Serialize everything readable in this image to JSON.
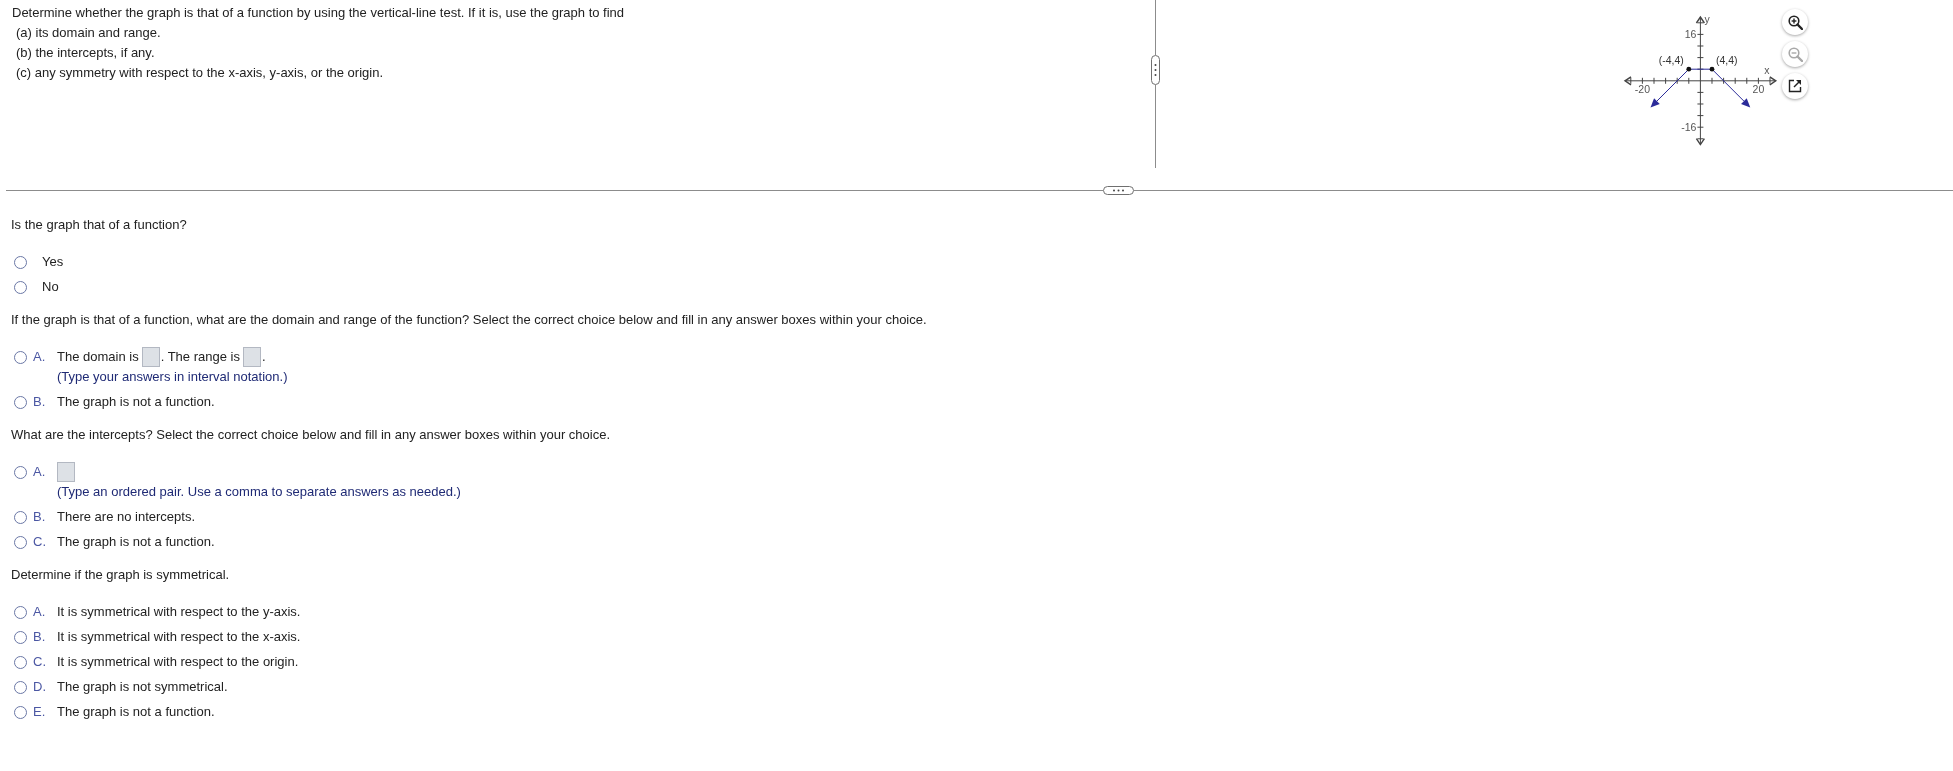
{
  "problem": {
    "intro": "Determine whether the graph is that of a function by using the vertical-line test. If it is, use the graph to find",
    "parts": [
      "(a) its domain and range.",
      "(b) the intercepts, if any.",
      "(c) any symmetry with respect to the x-axis, y-axis, or the origin."
    ]
  },
  "graph": {
    "chart_data": {
      "type": "line",
      "xlabel": "x",
      "ylabel": "y",
      "x": [
        -15,
        -4,
        4,
        15
      ],
      "series": [
        {
          "color": "#2b2b99",
          "values": [
            -7,
            4,
            4,
            -7
          ]
        }
      ],
      "xlim": [
        -26,
        26
      ],
      "ylim": [
        -22,
        22
      ],
      "xticks": [
        -20,
        20
      ],
      "yticks": [
        -16,
        16
      ],
      "annotations": [
        {
          "x": -4,
          "y": 4,
          "text": "(-4,4)"
        },
        {
          "x": 4,
          "y": 4,
          "text": "(4,4)"
        }
      ]
    },
    "tools": [
      {
        "kind": "zoom_in",
        "disabled": false
      },
      {
        "kind": "zoom_out",
        "disabled": true
      },
      {
        "kind": "popout",
        "disabled": false
      }
    ]
  },
  "questions": [
    {
      "prompt": "Is the graph that of a function?",
      "choices": [
        {
          "content": [
            {
              "kind": "text",
              "text": "Yes"
            }
          ],
          "selected": false
        },
        {
          "content": [
            {
              "kind": "text",
              "text": "No"
            }
          ],
          "selected": false
        }
      ]
    },
    {
      "prompt": "If the graph is that of a function, what are the domain and range of the function? Select the correct choice below and fill in any answer boxes within your choice.",
      "choices": [
        {
          "letter": "A.",
          "content": [
            {
              "kind": "text",
              "text": "The domain is"
            },
            {
              "kind": "answer_box"
            },
            {
              "kind": "text",
              "text": ". The range is"
            },
            {
              "kind": "answer_box"
            },
            {
              "kind": "text",
              "text": "."
            }
          ],
          "hint": "(Type your answers in interval notation.)",
          "selected": false
        },
        {
          "letter": "B.",
          "content": [
            {
              "kind": "text",
              "text": "The graph is not a function."
            }
          ],
          "selected": false
        }
      ]
    },
    {
      "prompt": "What are the intercepts? Select the correct choice below and fill in any answer boxes within your choice.",
      "choices": [
        {
          "letter": "A.",
          "content": [
            {
              "kind": "answer_box"
            }
          ],
          "hint": "(Type an ordered pair. Use a comma to separate answers as needed.)",
          "selected": false
        },
        {
          "letter": "B.",
          "content": [
            {
              "kind": "text",
              "text": "There are no intercepts."
            }
          ],
          "selected": false
        },
        {
          "letter": "C.",
          "content": [
            {
              "kind": "text",
              "text": "The graph is not a function."
            }
          ],
          "selected": false
        }
      ]
    },
    {
      "prompt": "Determine if the graph is symmetrical.",
      "choices": [
        {
          "letter": "A.",
          "content": [
            {
              "kind": "text",
              "text": "It is symmetrical with respect to the y-axis."
            }
          ],
          "selected": false
        },
        {
          "letter": "B.",
          "content": [
            {
              "kind": "text",
              "text": "It is symmetrical with respect to the x-axis."
            }
          ],
          "selected": false
        },
        {
          "letter": "C.",
          "content": [
            {
              "kind": "text",
              "text": "It is symmetrical with respect to the origin."
            }
          ],
          "selected": false
        },
        {
          "letter": "D.",
          "content": [
            {
              "kind": "text",
              "text": "The graph is not symmetrical."
            }
          ],
          "selected": false
        },
        {
          "letter": "E.",
          "content": [
            {
              "kind": "text",
              "text": "The graph is not a function."
            }
          ],
          "selected": false
        }
      ]
    }
  ]
}
